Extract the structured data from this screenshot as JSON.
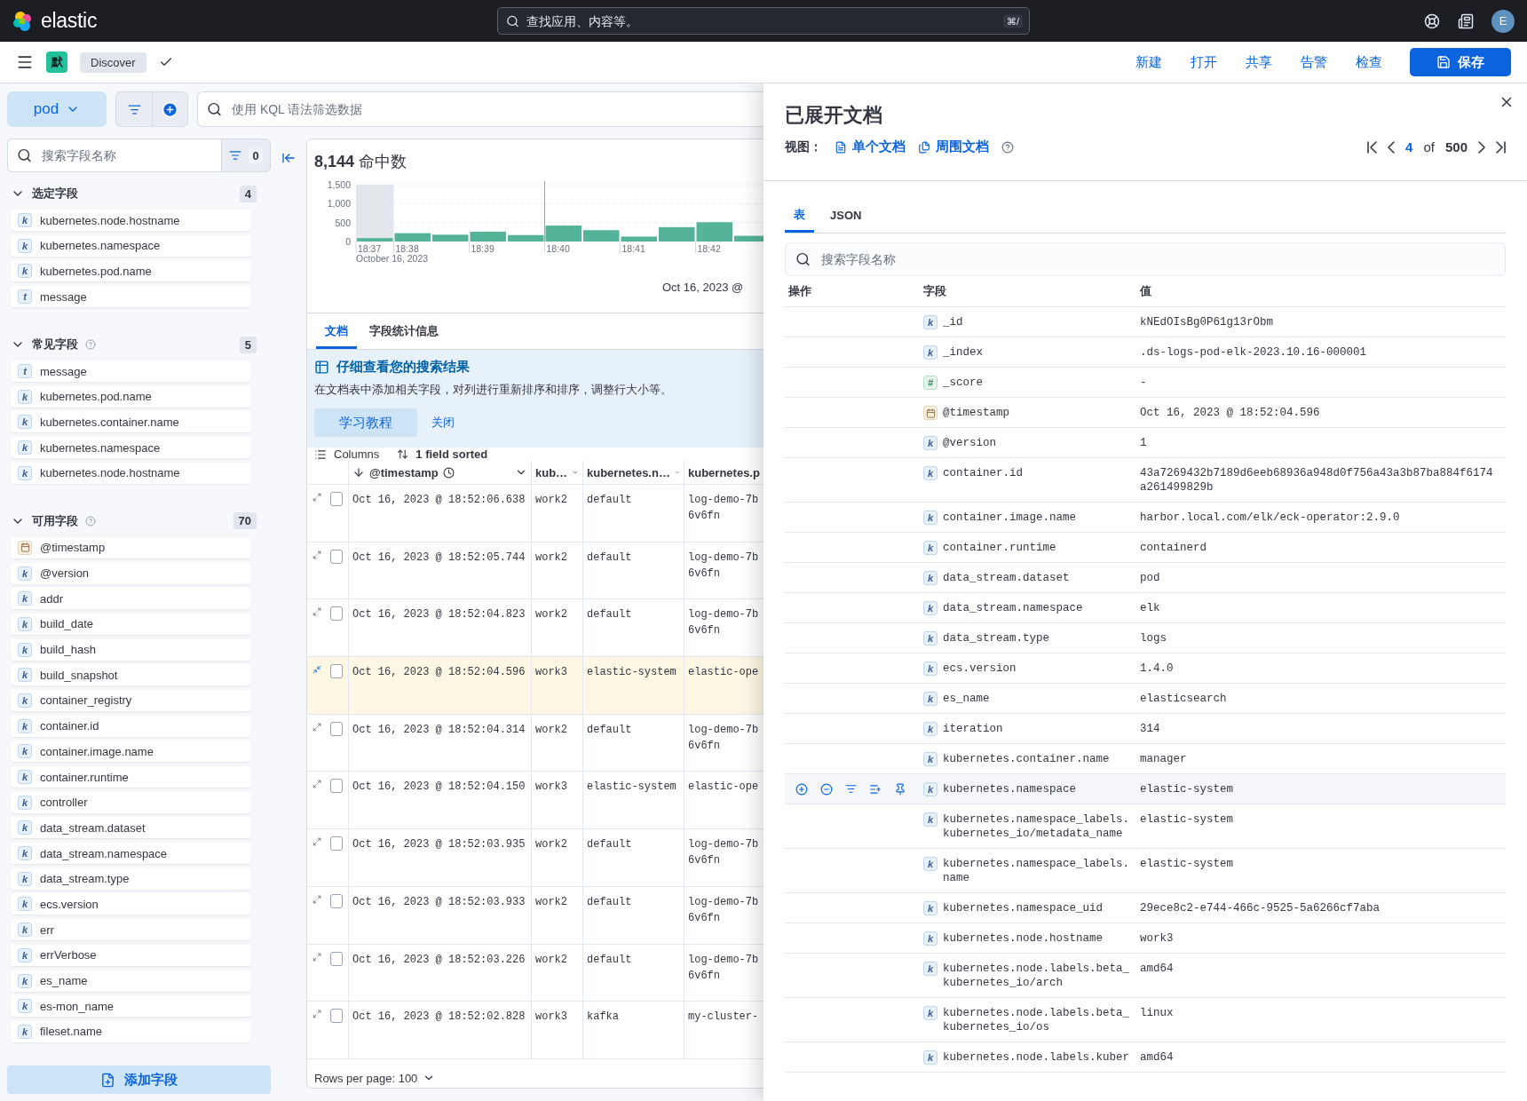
{
  "header": {
    "brand": "elastic",
    "search": {
      "placeholder": "查找应用、内容等。",
      "shortcut": "⌘/"
    },
    "avatar": "E"
  },
  "nav": {
    "space": "默",
    "app": "Discover",
    "actions": [
      "新建",
      "打开",
      "共享",
      "告警",
      "检查"
    ],
    "save": "保存"
  },
  "query": {
    "data_view": "pod",
    "placeholder": "使用 KQL 语法筛选数据"
  },
  "sidebar": {
    "search": {
      "placeholder": "搜索字段名称"
    },
    "filter_count": "0",
    "add_button": "添加字段",
    "sections": [
      {
        "title": "选定字段",
        "count": "4",
        "help": false,
        "expanded": true,
        "fields": [
          {
            "name": "kubernetes.node.hostname",
            "kind": "keyword",
            "badge": "k"
          },
          {
            "name": "kubernetes.namespace",
            "kind": "keyword",
            "badge": "k"
          },
          {
            "name": "kubernetes.pod.name",
            "kind": "keyword",
            "badge": "k"
          },
          {
            "name": "message",
            "kind": "text",
            "badge": "t"
          }
        ]
      },
      {
        "title": "常见字段",
        "count": "5",
        "help": true,
        "expanded": true,
        "fields": [
          {
            "name": "message",
            "kind": "text",
            "badge": "t"
          },
          {
            "name": "kubernetes.pod.name",
            "kind": "keyword",
            "badge": "k"
          },
          {
            "name": "kubernetes.container.name",
            "kind": "keyword",
            "badge": "k"
          },
          {
            "name": "kubernetes.namespace",
            "kind": "keyword",
            "badge": "k"
          },
          {
            "name": "kubernetes.node.hostname",
            "kind": "keyword",
            "badge": "k"
          }
        ]
      },
      {
        "title": "可用字段",
        "count": "70",
        "help": true,
        "expanded": true,
        "fields": [
          {
            "name": "@timestamp",
            "kind": "date"
          },
          {
            "name": "@version",
            "kind": "keyword",
            "badge": "k"
          },
          {
            "name": "addr",
            "kind": "keyword",
            "badge": "k"
          },
          {
            "name": "build_date",
            "kind": "keyword",
            "badge": "k"
          },
          {
            "name": "build_hash",
            "kind": "keyword",
            "badge": "k"
          },
          {
            "name": "build_snapshot",
            "kind": "keyword",
            "badge": "k"
          },
          {
            "name": "container_registry",
            "kind": "keyword",
            "badge": "k"
          },
          {
            "name": "container.id",
            "kind": "keyword",
            "badge": "k"
          },
          {
            "name": "container.image.name",
            "kind": "keyword",
            "badge": "k"
          },
          {
            "name": "container.runtime",
            "kind": "keyword",
            "badge": "k"
          },
          {
            "name": "controller",
            "kind": "keyword",
            "badge": "k"
          },
          {
            "name": "data_stream.dataset",
            "kind": "keyword",
            "badge": "k"
          },
          {
            "name": "data_stream.namespace",
            "kind": "keyword",
            "badge": "k"
          },
          {
            "name": "data_stream.type",
            "kind": "keyword",
            "badge": "k"
          },
          {
            "name": "ecs.version",
            "kind": "keyword",
            "badge": "k"
          },
          {
            "name": "err",
            "kind": "keyword",
            "badge": "k"
          },
          {
            "name": "errVerbose",
            "kind": "keyword",
            "badge": "k"
          },
          {
            "name": "es_name",
            "kind": "keyword",
            "badge": "k"
          },
          {
            "name": "es-mon_name",
            "kind": "keyword",
            "badge": "k"
          },
          {
            "name": "fileset.name",
            "kind": "keyword",
            "badge": "k"
          }
        ]
      }
    ]
  },
  "results": {
    "hits": "**8,144** 命中数",
    "chart_caption": "Oct 16, 2023 @",
    "chart_data": {
      "type": "bar",
      "xlabel": "October 16, 2023",
      "categories": [
        "18:37",
        "18:38",
        null,
        "18:39",
        null,
        "18:40",
        null,
        "18:41",
        null,
        "18:42",
        null
      ],
      "values": [
        90,
        220,
        180,
        260,
        170,
        420,
        300,
        130,
        380,
        510,
        150
      ],
      "ref_lines": [
        {
          "axis": "x",
          "value": "18:40"
        }
      ],
      "ylim": [
        0,
        1500
      ],
      "yticks": [
        0,
        {
          "value": 500,
          "label": "500"
        },
        {
          "value": 1000,
          "label": "1,000"
        },
        {
          "value": 1500,
          "label": "1,500"
        }
      ]
    },
    "tabs": [
      {
        "label": "文档",
        "selected": true
      },
      {
        "label": "字段统计信息",
        "selected": false
      }
    ],
    "callout": {
      "title": "仔细查看您的搜索结果",
      "text": "在文档表中添加相关字段，对列进行重新排序和排序，调整行大小等。",
      "button": "学习教程",
      "dismiss": "关闭"
    },
    "toolbar": {
      "columns": "Columns",
      "sorted": "1 field sorted"
    },
    "grid": {
      "columns": [
        "@timestamp",
        "kub…",
        "kubernetes.n…",
        "kubernetes.p"
      ],
      "rows": [
        {
          "timestamp": "Oct 16, 2023 @ 18:52:06.638",
          "node": "work2",
          "namespace": "default",
          "pod": "log-demo-7b\n6v6fn",
          "expanded": false,
          "checked": false
        },
        {
          "timestamp": "Oct 16, 2023 @ 18:52:05.744",
          "node": "work2",
          "namespace": "default",
          "pod": "log-demo-7b\n6v6fn",
          "expanded": false,
          "checked": false
        },
        {
          "timestamp": "Oct 16, 2023 @ 18:52:04.823",
          "node": "work2",
          "namespace": "default",
          "pod": "log-demo-7b\n6v6fn",
          "expanded": false,
          "checked": false
        },
        {
          "timestamp": "Oct 16, 2023 @ 18:52:04.596",
          "node": "work3",
          "namespace": "elastic-system",
          "pod": "elastic-ope",
          "expanded": true,
          "checked": false
        },
        {
          "timestamp": "Oct 16, 2023 @ 18:52:04.314",
          "node": "work2",
          "namespace": "default",
          "pod": "log-demo-7b\n6v6fn",
          "expanded": false,
          "checked": false
        },
        {
          "timestamp": "Oct 16, 2023 @ 18:52:04.150",
          "node": "work3",
          "namespace": "elastic-system",
          "pod": "elastic-ope",
          "expanded": false,
          "checked": false
        },
        {
          "timestamp": "Oct 16, 2023 @ 18:52:03.935",
          "node": "work2",
          "namespace": "default",
          "pod": "log-demo-7b\n6v6fn",
          "expanded": false,
          "checked": false
        },
        {
          "timestamp": "Oct 16, 2023 @ 18:52:03.933",
          "node": "work2",
          "namespace": "default",
          "pod": "log-demo-7b\n6v6fn",
          "expanded": false,
          "checked": false
        },
        {
          "timestamp": "Oct 16, 2023 @ 18:52:03.226",
          "node": "work2",
          "namespace": "default",
          "pod": "log-demo-7b\n6v6fn",
          "expanded": false,
          "checked": false
        },
        {
          "timestamp": "Oct 16, 2023 @ 18:52:02.828",
          "node": "work3",
          "namespace": "kafka",
          "pod": "my-cluster-",
          "expanded": false,
          "checked": false
        }
      ],
      "footer": "Rows per page: 100"
    }
  },
  "flyout": {
    "title": "已展开文档",
    "view_label": "视图：",
    "views": [
      "单个文档",
      "周围文档"
    ],
    "pager": {
      "current": "4",
      "of": "of",
      "total": "500"
    },
    "tabs": [
      {
        "label": "表",
        "selected": true
      },
      {
        "label": "JSON",
        "selected": false
      }
    ],
    "search": {
      "placeholder": "搜索字段名称"
    },
    "columns": [
      "操作",
      "字段",
      "值"
    ],
    "rows": [
      {
        "field": "_id",
        "kind": "keyword",
        "badge": "k",
        "value": "kNEdOIsBg0P61g13rObm",
        "hovered": false
      },
      {
        "field": "_index",
        "kind": "keyword",
        "badge": "k",
        "value": ".ds-logs-pod-elk-2023.10.16-000001",
        "hovered": false
      },
      {
        "field": "_score",
        "kind": "number",
        "badge": "#",
        "value": " -",
        "hovered": false
      },
      {
        "field": "@timestamp",
        "kind": "date",
        "value": "Oct 16, 2023 @ 18:52:04.596",
        "hovered": false
      },
      {
        "field": "@version",
        "kind": "keyword",
        "badge": "k",
        "value": "1",
        "hovered": false
      },
      {
        "field": "container.id",
        "kind": "keyword",
        "badge": "k",
        "value": "43a7269432b7189d6eeb68936a948d0f756a43a3b87ba884f6174a261499829b",
        "hovered": false
      },
      {
        "field": "container.image.name",
        "kind": "keyword",
        "badge": "k",
        "value": "harbor.local.com/elk/eck-operator:2.9.0",
        "hovered": false
      },
      {
        "field": "container.runtime",
        "kind": "keyword",
        "badge": "k",
        "value": "containerd",
        "hovered": false
      },
      {
        "field": "data_stream.dataset",
        "kind": "keyword",
        "badge": "k",
        "value": "pod",
        "hovered": false
      },
      {
        "field": "data_stream.namespace",
        "kind": "keyword",
        "badge": "k",
        "value": "elk",
        "hovered": false
      },
      {
        "field": "data_stream.type",
        "kind": "keyword",
        "badge": "k",
        "value": "logs",
        "hovered": false
      },
      {
        "field": "ecs.version",
        "kind": "keyword",
        "badge": "k",
        "value": "1.4.0",
        "hovered": false
      },
      {
        "field": "es_name",
        "kind": "keyword",
        "badge": "k",
        "value": "elasticsearch",
        "hovered": false
      },
      {
        "field": "iteration",
        "kind": "keyword",
        "badge": "k",
        "value": "314",
        "hovered": false
      },
      {
        "field": "kubernetes.container.name",
        "kind": "keyword",
        "badge": "k",
        "value": "manager",
        "hovered": false
      },
      {
        "field": "kubernetes.namespace",
        "kind": "keyword",
        "badge": "k",
        "value": "elastic-system",
        "hovered": true
      },
      {
        "field": "kubernetes.namespace_labels.\nkubernetes_io/metadata_name",
        "kind": "keyword",
        "badge": "k",
        "value": "elastic-system",
        "hovered": false
      },
      {
        "field": "kubernetes.namespace_labels.\nname",
        "kind": "keyword",
        "badge": "k",
        "value": "elastic-system",
        "hovered": false
      },
      {
        "field": "kubernetes.namespace_uid",
        "kind": "keyword",
        "badge": "k",
        "value": "29ece8c2-e744-466c-9525-5a6266cf7aba",
        "hovered": false
      },
      {
        "field": "kubernetes.node.hostname",
        "kind": "keyword",
        "badge": "k",
        "value": "work3",
        "hovered": false
      },
      {
        "field": "kubernetes.node.labels.beta_\nkubernetes_io/arch",
        "kind": "keyword",
        "badge": "k",
        "value": "amd64",
        "hovered": false
      },
      {
        "field": "kubernetes.node.labels.beta_\nkubernetes_io/os",
        "kind": "keyword",
        "badge": "k",
        "value": "linux",
        "hovered": false
      },
      {
        "field": "kubernetes.node.labels.kuber",
        "kind": "keyword",
        "badge": "k",
        "value": "amd64",
        "hovered": false
      }
    ]
  }
}
